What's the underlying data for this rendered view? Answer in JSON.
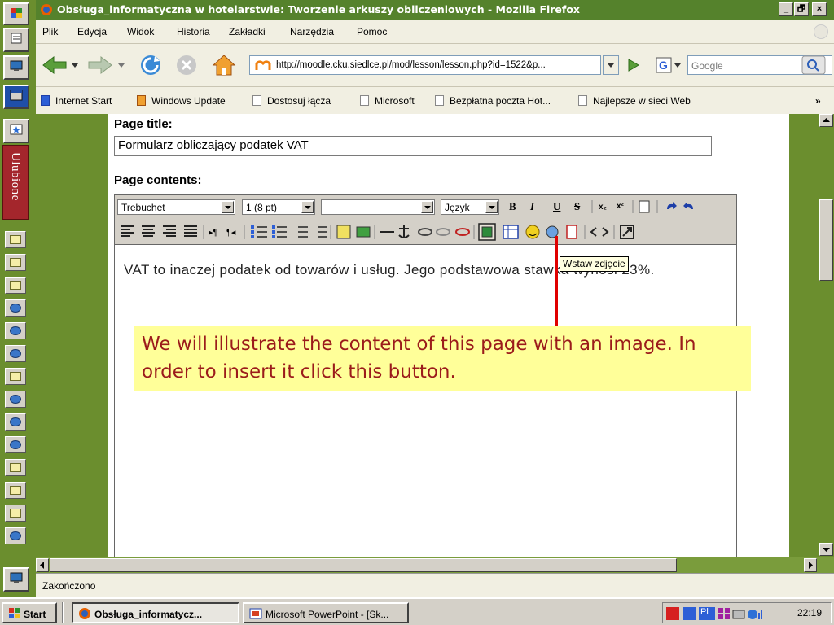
{
  "window": {
    "title": "Obsługa_informatyczna w hotelarstwie: Tworzenie arkuszy obliczeniowych - Mozilla Firefox",
    "minimize": "_",
    "maximize": "🗗",
    "close": "×"
  },
  "menu": [
    "Plik",
    "Edycja",
    "Widok",
    "Historia",
    "Zakładki",
    "Narzędzia",
    "Pomoc"
  ],
  "navigation": {
    "url": "http://moodle.cku.siedlce.pl/mod/lesson/lesson.php?id=1522&p...",
    "search_placeholder": "Google"
  },
  "bookmarks": [
    "Internet Start",
    "Windows Update",
    "Dostosuj łącza",
    "Microsoft",
    "Bezpłatna poczta Hot...",
    "Najlepsze w sieci Web"
  ],
  "bookmarks_overflow": "»",
  "sidebar": {
    "favorites_label": "Ulubione",
    "favorites_icons": [
      "folder",
      "folder",
      "folder",
      "ie",
      "ie",
      "ie",
      "bell",
      "ie",
      "ie",
      "ie",
      "folder",
      "folder",
      "folder",
      "ie"
    ]
  },
  "form": {
    "page_title_label": "Page title:",
    "page_title_value": "Formularz obliczający podatek VAT",
    "page_contents_label": "Page contents:",
    "font_family": "Trebuchet",
    "font_size": "1 (8 pt)",
    "format_value": "",
    "language": "Język",
    "bold": "B",
    "italic": "I",
    "underline": "U",
    "strike": "S",
    "body_text": "VAT to inaczej podatek od towarów i usług. Jego podstawowa stawka wynosi 23%.",
    "tooltip": "Wstaw zdjęcie"
  },
  "callout": {
    "text": "We will illustrate the content of this page with an image. In order to insert it click this button."
  },
  "status": {
    "text": "Zakończono"
  },
  "taskbar": {
    "start": "Start",
    "tasks": [
      "Obsługa_informatycz...",
      "Microsoft PowerPoint - [Sk..."
    ],
    "lang": "Pl",
    "time": "22:19"
  },
  "colors": {
    "accent": "#6b8e2e",
    "callout_bg": "#ffff99",
    "callout_text": "#9b1b1b",
    "arrow": "#e00000"
  }
}
